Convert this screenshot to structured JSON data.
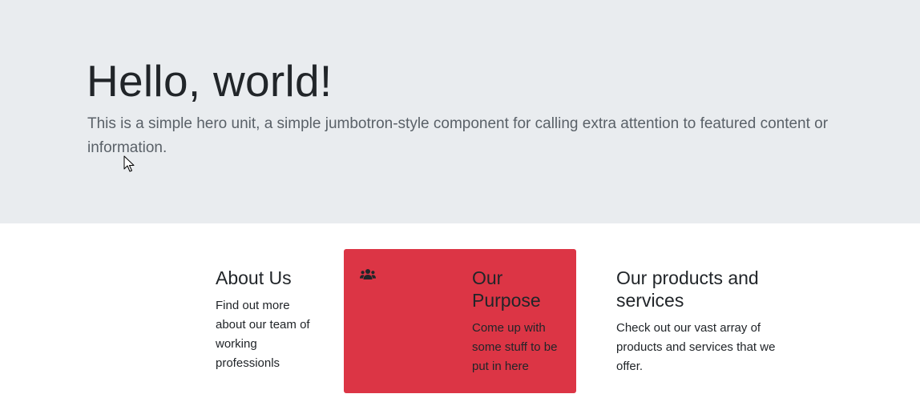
{
  "hero": {
    "title": "Hello, world!",
    "lead": "This is a simple hero unit, a simple jumbotron-style component for calling extra attention to featured content or information."
  },
  "cards": {
    "about": {
      "title": "About Us",
      "text": "Find out more about our team of working professionls"
    },
    "purpose": {
      "icon": "users-icon",
      "title": "Our Purpose",
      "text": "Come up with some stuff to be put in here",
      "background": "#dc3545"
    },
    "products": {
      "title": "Our products and services",
      "text": "Check out our vast array of products and services that we offer."
    }
  },
  "colors": {
    "jumbotron_bg": "#e9ecef",
    "accent": "#dc3545"
  }
}
